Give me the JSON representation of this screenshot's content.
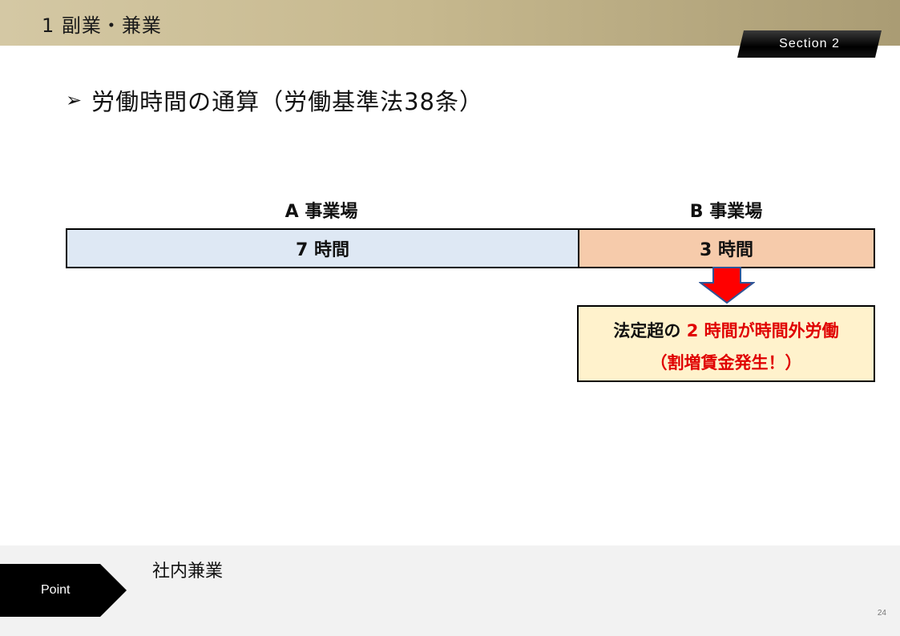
{
  "header": {
    "title": "1 副業・兼業"
  },
  "section_badge": {
    "label": "Section 2"
  },
  "slide": {
    "heading_icon": "right-arrowhead-icon",
    "heading": "労働時間の通算（労働基準法38条）"
  },
  "workplaces": {
    "a": {
      "label": "A 事業場",
      "hours": "7 時間"
    },
    "b": {
      "label": "B 事業場",
      "hours": "3 時間"
    }
  },
  "overtime": {
    "prefix": "法定超の ",
    "hours": "2 時間",
    "suffix": "が時間外労働",
    "note": "（割増賃金発生！）"
  },
  "footer": {
    "point_label": "Point",
    "point_text": "社内兼業",
    "page_number": "24"
  },
  "colors": {
    "header_gold": "#c7b98f",
    "workplace_a_fill": "#dee8f4",
    "workplace_b_fill": "#f6cbab",
    "overtime_fill": "#fff2cc",
    "emphasis_red": "#e00000",
    "arrow_red": "#ff0000",
    "arrow_outline": "#2f5597"
  }
}
